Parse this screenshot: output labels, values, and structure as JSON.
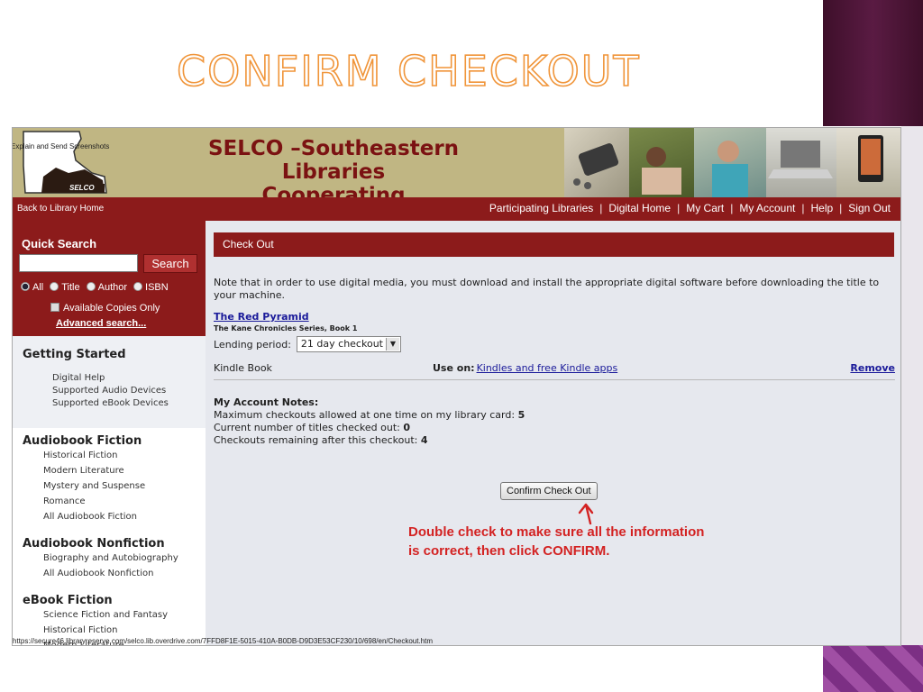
{
  "slide": {
    "title": "CONFIRM CHECKOUT"
  },
  "banner": {
    "explain_text": "Explain and Send Screenshots",
    "logo_text": "SELCO",
    "brand_line1": "SELCO –Southeastern Libraries",
    "brand_line2": "Cooperating"
  },
  "topnav": {
    "back": "Back to Library Home",
    "links": [
      "Participating Libraries",
      "Digital Home",
      "My Cart",
      "My Account",
      "Help",
      "Sign Out"
    ],
    "separator": "|"
  },
  "quick_search": {
    "title": "Quick Search",
    "button": "Search",
    "input_value": "",
    "options": [
      "All",
      "Title",
      "Author",
      "ISBN"
    ],
    "selected_option": "All",
    "available_only": "Available Copies Only",
    "advanced": "Advanced search..."
  },
  "sidebar": {
    "getting_started": {
      "title": "Getting Started",
      "items": [
        "Digital Help",
        "Supported Audio Devices",
        "Supported eBook Devices"
      ]
    },
    "audiobook_fiction": {
      "title": "Audiobook Fiction",
      "items": [
        "Historical Fiction",
        "Modern Literature",
        "Mystery and Suspense",
        "Romance",
        "All Audiobook Fiction"
      ]
    },
    "audiobook_nonfiction": {
      "title": "Audiobook Nonfiction",
      "items": [
        "Biography and Autobiography",
        "All Audiobook Nonfiction"
      ]
    },
    "ebook_fiction": {
      "title": "eBook Fiction",
      "items": [
        "Science Fiction and Fantasy",
        "Historical Fiction",
        "Modern Literature"
      ]
    }
  },
  "checkout": {
    "header": "Check Out",
    "note": "Note that in order to use digital media, you must download and install the appropriate digital software before downloading the title to your machine.",
    "book_title": "The Red Pyramid",
    "book_series": "The Kane Chronicles Series, Book 1",
    "lending_label": "Lending period:",
    "lending_value": "21 day checkout",
    "format": "Kindle Book",
    "use_on_label": "Use on:",
    "use_on_link": "Kindles and free Kindle apps",
    "remove": "Remove",
    "notes_title": "My Account Notes:",
    "max_label": "Maximum checkouts allowed at one time on my library card: ",
    "max_value": "5",
    "current_label": "Current number of titles checked out: ",
    "current_value": "0",
    "remaining_label": "Checkouts remaining after this checkout: ",
    "remaining_value": "4",
    "confirm_button": "Confirm Check Out"
  },
  "callout": {
    "line1": "Double check to make sure all the information",
    "line2": "is correct, then click CONFIRM.",
    "color": "#d32222"
  },
  "status_url": "https://secure46.libraryreserve.com/selco.lib.overdrive.com/7FFD8F1E-5015-410A-B0DB-D9D3E53CF230/10/698/en/Checkout.htm",
  "colors": {
    "title_outline": "#f0953a",
    "header_red": "#8c1b1b",
    "banner": "#c0b683",
    "link_blue": "#1a1a9a"
  }
}
